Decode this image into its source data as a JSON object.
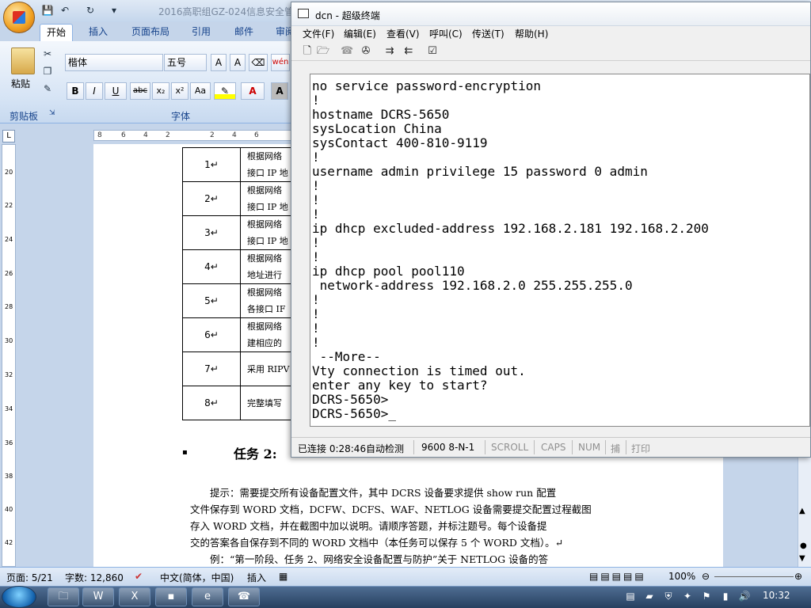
{
  "word": {
    "title": "2016高职组GZ-024信息安全管",
    "tabs": [
      "开始",
      "插入",
      "页面布局",
      "引用",
      "邮件",
      "审阅"
    ],
    "font_name": "楷体",
    "font_size": "五号",
    "paste_label": "粘贴",
    "groups": {
      "clipboard": "剪贴板",
      "font": "字体"
    },
    "format_buttons": [
      "B",
      "I",
      "U",
      "abc",
      "x₂",
      "x²",
      "Aa"
    ],
    "hruler_ticks": [
      "8",
      "6",
      "4",
      "2",
      "2",
      "4",
      "6"
    ],
    "vruler_ticks": [
      "20",
      "22",
      "24",
      "26",
      "28",
      "30",
      "32",
      "34",
      "36",
      "38",
      "40",
      "42"
    ],
    "table": [
      {
        "num": "1↵",
        "lines": [
          "根据网络",
          "接口 IP 地"
        ]
      },
      {
        "num": "2↵",
        "lines": [
          "根据网络",
          "接口 IP 地"
        ]
      },
      {
        "num": "3↵",
        "lines": [
          "根据网络",
          "接口 IP 地"
        ]
      },
      {
        "num": "4↵",
        "lines": [
          "根据网络",
          "地址进行"
        ]
      },
      {
        "num": "5↵",
        "lines": [
          "根据网络",
          "各接口 IF"
        ]
      },
      {
        "num": "6↵",
        "lines": [
          "根据网络",
          "建相应的"
        ]
      },
      {
        "num": "7↵",
        "lines": [
          "采用 RIPV"
        ]
      },
      {
        "num": "8↵",
        "lines": [
          "完整填写"
        ]
      }
    ],
    "task_heading": "任务 2:",
    "paragraphs": [
      "提示：需要提交所有设备配置文件，其中 DCRS 设备要求提供 show run 配置",
      "文件保存到 WORD 文档，DCFW、DCFS、WAF、NETLOG 设备需要提交配置过程截图",
      "存入 WORD 文档，并在截图中加以说明。请顺序答题，并标注题号。每个设备提",
      "交的答案各自保存到不同的 WORD 文档中（本任务可以保存 5 个 WORD 文档）。↵",
      "例：“第一阶段、任务 2、网络安全设备配置与防护”关于 NETLOG 设备的答"
    ],
    "status": {
      "page": "页面: 5/21",
      "words": "字数: 12,860",
      "lang": "中文(简体，中国)",
      "mode": "插入",
      "zoom": "100%"
    }
  },
  "terminal": {
    "title": "dcn - 超级终端",
    "menus": [
      "文件(F)",
      "编辑(E)",
      "查看(V)",
      "呼叫(C)",
      "传送(T)",
      "帮助(H)"
    ],
    "lines": [
      "no service password-encryption",
      "!",
      "hostname DCRS-5650",
      "sysLocation China",
      "sysContact 400-810-9119",
      "!",
      "username admin privilege 15 password 0 admin",
      "!",
      "!",
      "!",
      "ip dhcp excluded-address 192.168.2.181 192.168.2.200",
      "!",
      "!",
      "ip dhcp pool pool110",
      " network-address 192.168.2.0 255.255.255.0",
      "!",
      "!",
      "!",
      "!",
      " --More--",
      "Vty connection is timed out.",
      "enter any key to start?",
      "DCRS-5650>",
      "DCRS-5650>_"
    ],
    "status": {
      "connected": "已连接 0:28:46",
      "detect": "自动检测",
      "baud": "9600 8-N-1",
      "scroll": "SCROLL",
      "caps": "CAPS",
      "num": "NUM",
      "capture": "捕",
      "print": "打印"
    }
  },
  "taskbar": {
    "clock": "10:32"
  }
}
